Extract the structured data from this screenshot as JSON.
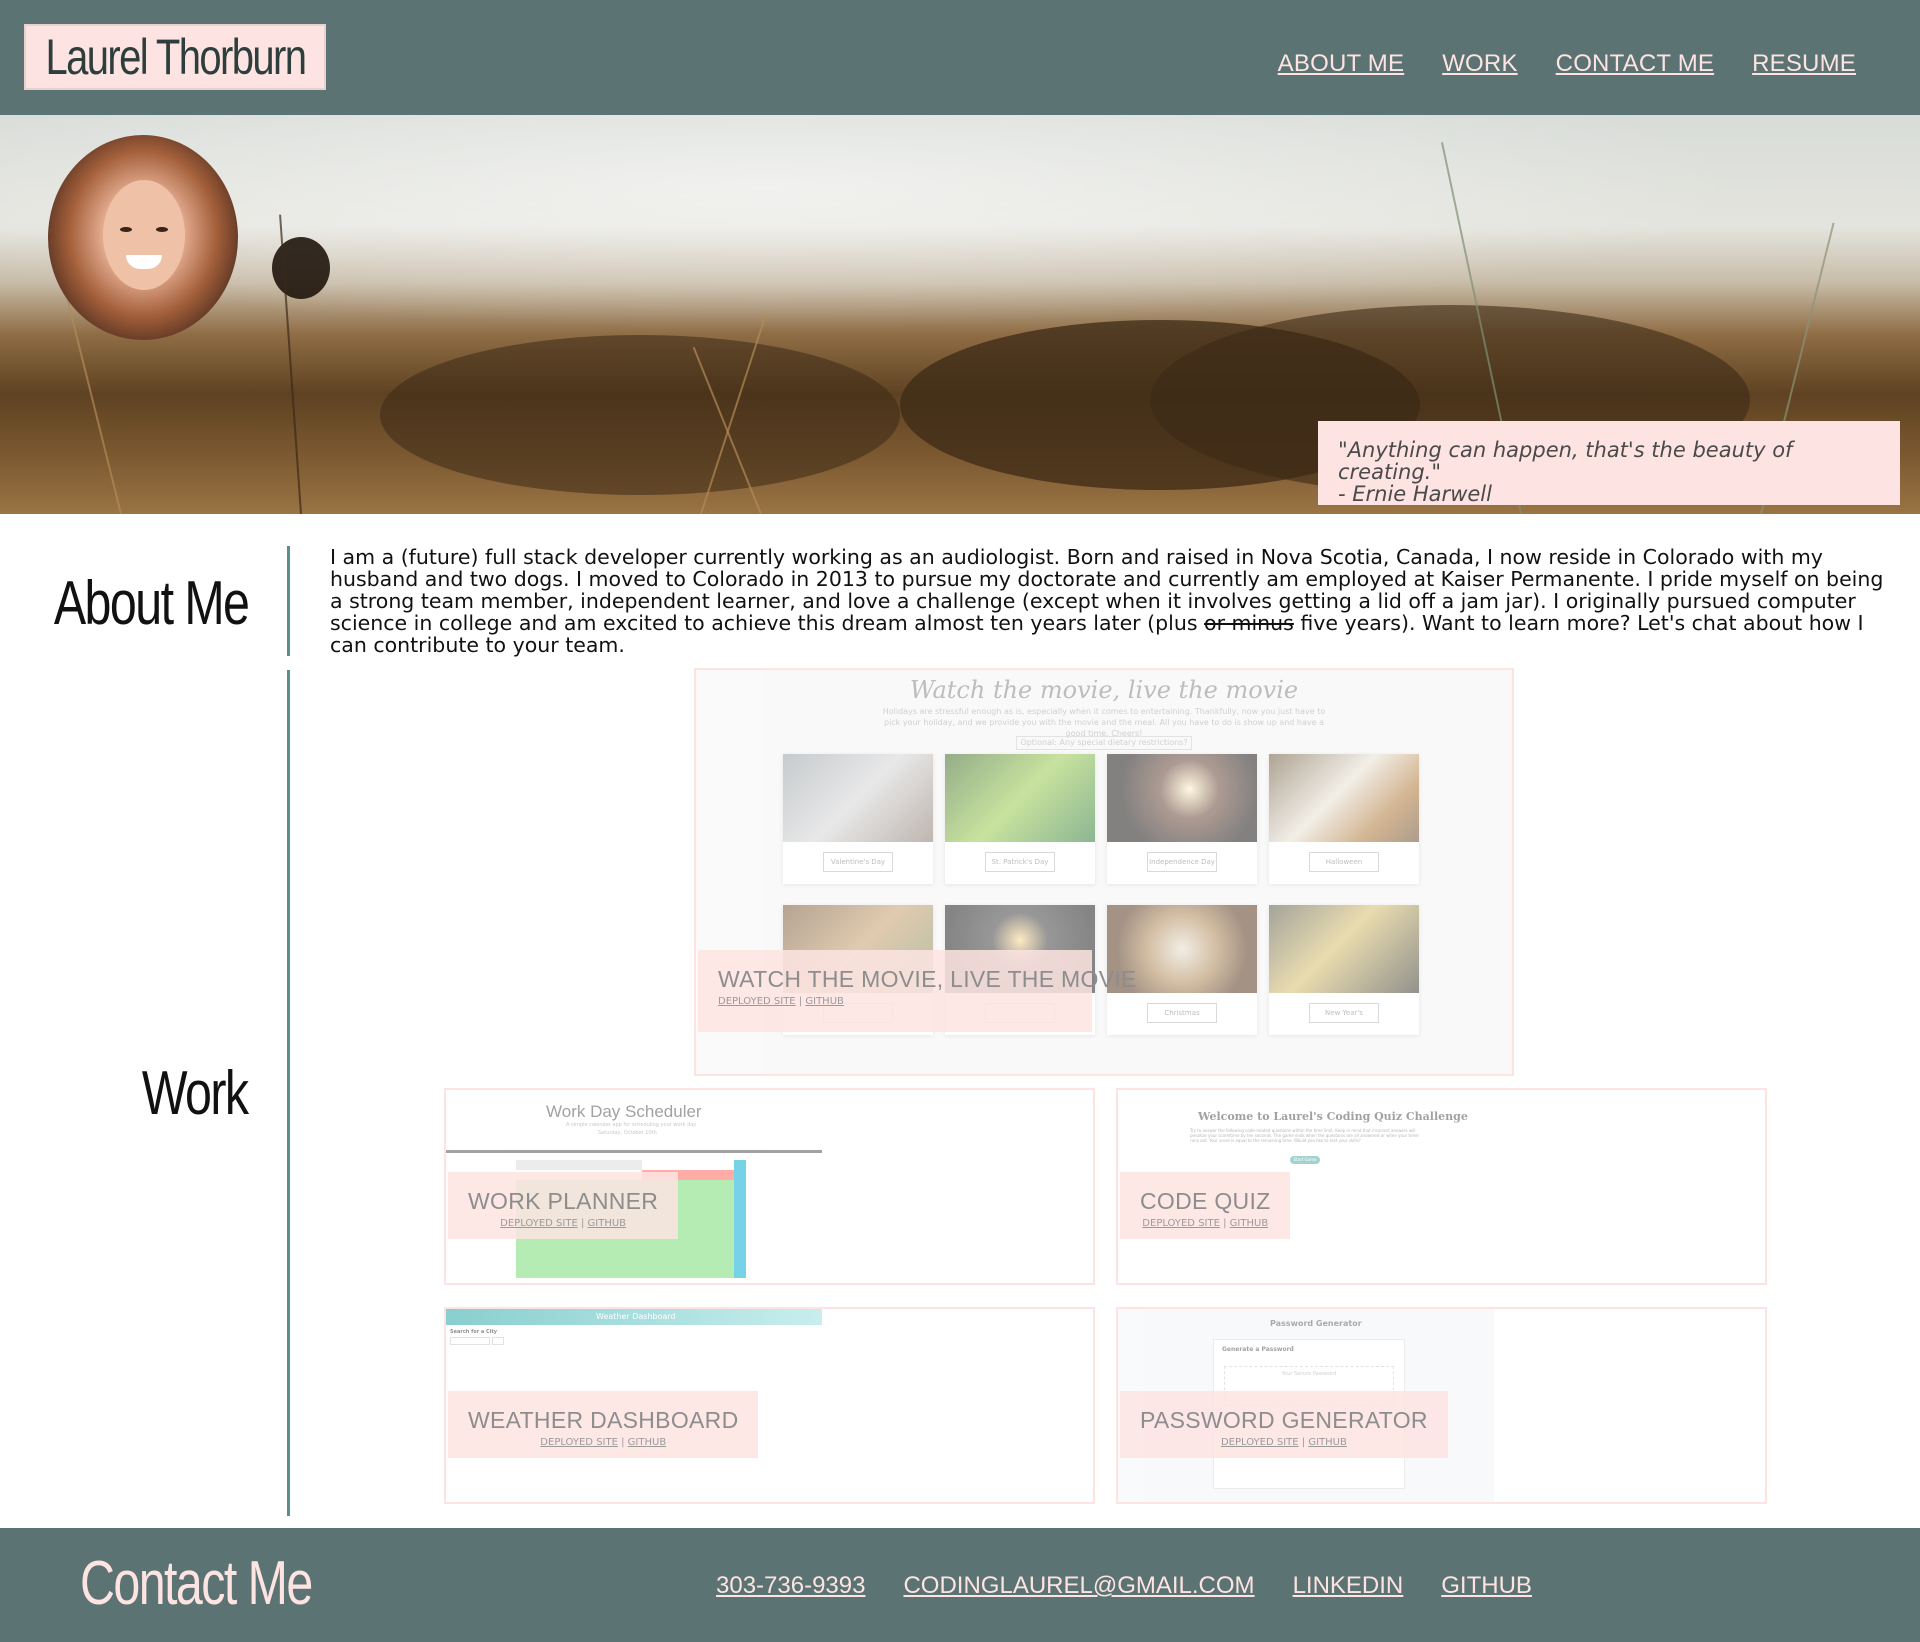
{
  "header": {
    "logo_text": "Laurel Thorburn",
    "nav": [
      "ABOUT ME",
      "WORK",
      "CONTACT ME",
      "RESUME"
    ]
  },
  "hero": {
    "quote_line1": "\"Anything can happen, that's the beauty of creating.\"",
    "quote_line2": "- Ernie Harwell"
  },
  "about": {
    "title": "About Me",
    "text_before": "I am a (future) full stack developer currently working as an audiologist. Born and raised in Nova Scotia, Canada, I now reside in Colorado with my husband and two dogs. I moved to Colorado in 2013 to pursue my doctorate and currently am employed at Kaiser Permanente. I pride myself on being a strong team member, independent learner, and love a challenge (except when it involves getting a lid off a jam jar). I originally pursued computer science in college and am excited to achieve this dream almost ten years later (plus ",
    "text_struck": "or minus",
    "text_after": " five years). Want to learn more? Let's chat about how I can contribute to your team."
  },
  "work": {
    "title": "Work",
    "featured": {
      "name": "WATCH THE MOVIE, LIVE THE MOVIE",
      "deployed": "DEPLOYED SITE",
      "sep": "|",
      "github": "GITHUB",
      "screenshot": {
        "title": "Watch the movie, live the movie",
        "subtitle": "Holidays are stressful enough as is, especially when it comes to entertaining. Thankfully, now you just have to pick your holiday, and we provide you with the movie and the meal. All you have to do is show up and have a good time. Cheers!",
        "dropdown": "Optional: Any special dietary restrictions?",
        "tiles": [
          "Valentine's Day",
          "St. Patrick's Day",
          "Independence Day",
          "Halloween",
          "",
          "",
          "Christmas",
          "New Year's"
        ]
      }
    },
    "projects": [
      {
        "name": "WORK PLANNER",
        "deployed": "DEPLOYED SITE",
        "github": "GITHUB",
        "shot_title": "Work Day Scheduler",
        "shot_sub": "A simple calendar app for scheduling your work day",
        "shot_date": "Saturday, October 10th"
      },
      {
        "name": "CODE QUIZ",
        "deployed": "DEPLOYED SITE",
        "github": "GITHUB",
        "shot_title": "Welcome to Laurel's Coding Quiz Challenge",
        "shot_sub": "Try to answer the following code-related questions within the time limit. Keep in mind that incorrect answers will penalize your score/time by ten seconds. The game ends when the questions are all answered or when your timer runs out. Your score is equal to the remaining time. Would you like to test your skills?",
        "shot_button": "Start Game"
      },
      {
        "name": "WEATHER DASHBOARD",
        "deployed": "DEPLOYED SITE",
        "github": "GITHUB",
        "shot_title": "Weather Dashboard",
        "shot_sub": "Search for a City"
      },
      {
        "name": "PASSWORD GENERATOR",
        "deployed": "DEPLOYED SITE",
        "github": "GITHUB",
        "shot_title": "Password Generator",
        "shot_sub": "Generate a Password",
        "shot_placeholder": "Your Secure Password"
      }
    ]
  },
  "contact": {
    "title": "Contact Me",
    "links": [
      "303-736-9393",
      "CODINGLAUREL@GMAIL.COM",
      "LINKEDIN",
      "GITHUB"
    ]
  },
  "colors": {
    "header_bg": "#5b7372",
    "accent_pink": "#fde4e2",
    "divider_teal": "#5b8f8a"
  }
}
